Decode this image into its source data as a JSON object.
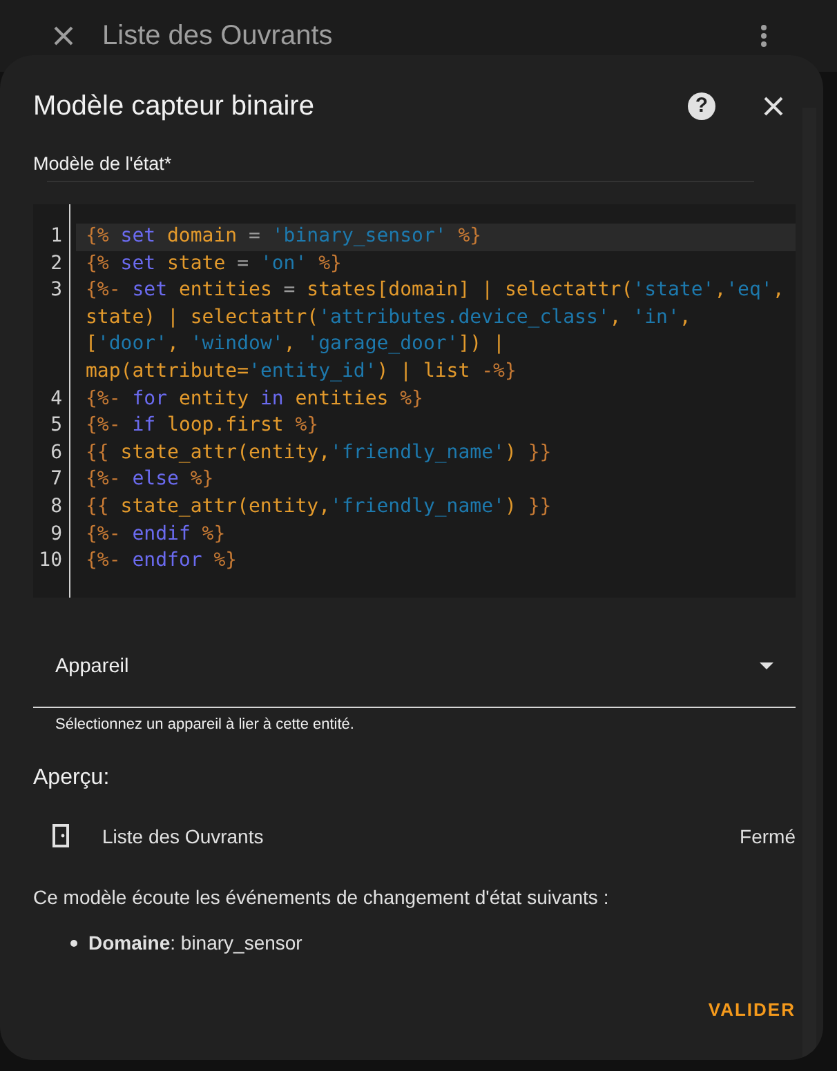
{
  "app_bar": {
    "title": "Liste des Ouvrants"
  },
  "dialog": {
    "title": "Modèle capteur binaire",
    "help_icon": "?",
    "template_label": "Modèle de l'état*",
    "code": [
      {
        "number": "1",
        "active": true,
        "tokens": [
          {
            "kind": "delim",
            "text": "{%"
          },
          {
            "kind": "kw",
            "text": " set"
          },
          {
            "kind": "name",
            "text": " domain"
          },
          {
            "kind": "op",
            "text": " ="
          },
          {
            "kind": "str",
            "text": " 'binary_sensor'"
          },
          {
            "kind": "delim",
            "text": " %}"
          }
        ]
      },
      {
        "number": "2",
        "active": false,
        "tokens": [
          {
            "kind": "delim",
            "text": "{%"
          },
          {
            "kind": "kw",
            "text": " set"
          },
          {
            "kind": "name",
            "text": " state"
          },
          {
            "kind": "op",
            "text": " ="
          },
          {
            "kind": "str",
            "text": " 'on'"
          },
          {
            "kind": "delim",
            "text": " %}"
          }
        ]
      },
      {
        "number": "3",
        "active": false,
        "tokens": [
          {
            "kind": "delim",
            "text": "{%-"
          },
          {
            "kind": "kw",
            "text": " set"
          },
          {
            "kind": "name",
            "text": " entities"
          },
          {
            "kind": "op",
            "text": " ="
          },
          {
            "kind": "name",
            "text": " states[domain] | selectattr("
          },
          {
            "kind": "str",
            "text": "'state'"
          },
          {
            "kind": "name",
            "text": ","
          },
          {
            "kind": "str",
            "text": "'eq'"
          },
          {
            "kind": "name",
            "text": ", state) | selectattr("
          },
          {
            "kind": "str",
            "text": "'attributes.device_class'"
          },
          {
            "kind": "name",
            "text": ", "
          },
          {
            "kind": "str",
            "text": "'in'"
          },
          {
            "kind": "name",
            "text": ", ["
          },
          {
            "kind": "str",
            "text": "'door'"
          },
          {
            "kind": "name",
            "text": ", "
          },
          {
            "kind": "str",
            "text": "'window'"
          },
          {
            "kind": "name",
            "text": ", "
          },
          {
            "kind": "str",
            "text": "'garage_door'"
          },
          {
            "kind": "name",
            "text": "]) | map(attribute="
          },
          {
            "kind": "str",
            "text": "'entity_id'"
          },
          {
            "kind": "name",
            "text": ") | list"
          },
          {
            "kind": "delim",
            "text": " -%}"
          }
        ]
      },
      {
        "number": "4",
        "active": false,
        "tokens": [
          {
            "kind": "delim",
            "text": "{%-"
          },
          {
            "kind": "kw",
            "text": " for"
          },
          {
            "kind": "name",
            "text": " entity"
          },
          {
            "kind": "kw",
            "text": " in"
          },
          {
            "kind": "name",
            "text": " entities"
          },
          {
            "kind": "delim",
            "text": " %}"
          }
        ]
      },
      {
        "number": "5",
        "active": false,
        "tokens": [
          {
            "kind": "delim",
            "text": "{%-"
          },
          {
            "kind": "kw",
            "text": " if"
          },
          {
            "kind": "name",
            "text": " loop.first"
          },
          {
            "kind": "delim",
            "text": " %}"
          }
        ]
      },
      {
        "number": "6",
        "active": false,
        "tokens": [
          {
            "kind": "delim",
            "text": "{{"
          },
          {
            "kind": "name",
            "text": " state_attr(entity,"
          },
          {
            "kind": "str",
            "text": "'friendly_name'"
          },
          {
            "kind": "name",
            "text": ")"
          },
          {
            "kind": "delim",
            "text": " }}"
          }
        ]
      },
      {
        "number": "7",
        "active": false,
        "tokens": [
          {
            "kind": "delim",
            "text": "{%-"
          },
          {
            "kind": "kw",
            "text": " else"
          },
          {
            "kind": "delim",
            "text": " %}"
          }
        ]
      },
      {
        "number": "8",
        "active": false,
        "tokens": [
          {
            "kind": "delim",
            "text": "{{"
          },
          {
            "kind": "name",
            "text": " state_attr(entity,"
          },
          {
            "kind": "str",
            "text": "'friendly_name'"
          },
          {
            "kind": "name",
            "text": ")"
          },
          {
            "kind": "delim",
            "text": " }}"
          }
        ]
      },
      {
        "number": "9",
        "active": false,
        "tokens": [
          {
            "kind": "delim",
            "text": "{%-"
          },
          {
            "kind": "kw",
            "text": " endif"
          },
          {
            "kind": "delim",
            "text": " %}"
          }
        ]
      },
      {
        "number": "10",
        "active": false,
        "tokens": [
          {
            "kind": "delim",
            "text": "{%-"
          },
          {
            "kind": "kw",
            "text": " endfor"
          },
          {
            "kind": "delim",
            "text": " %}"
          }
        ]
      }
    ],
    "device_field": {
      "label": "Appareil",
      "helper": "Sélectionnez un appareil à lier à cette entité."
    },
    "preview_heading": "Aperçu:",
    "preview_entity": {
      "name": "Liste des Ouvrants",
      "state": "Fermé"
    },
    "listener_text": "Ce modèle écoute les événements de changement d'état suivants :",
    "listeners": [
      "**Domaine**: binary_sensor"
    ],
    "submit_button": "VALIDER"
  }
}
